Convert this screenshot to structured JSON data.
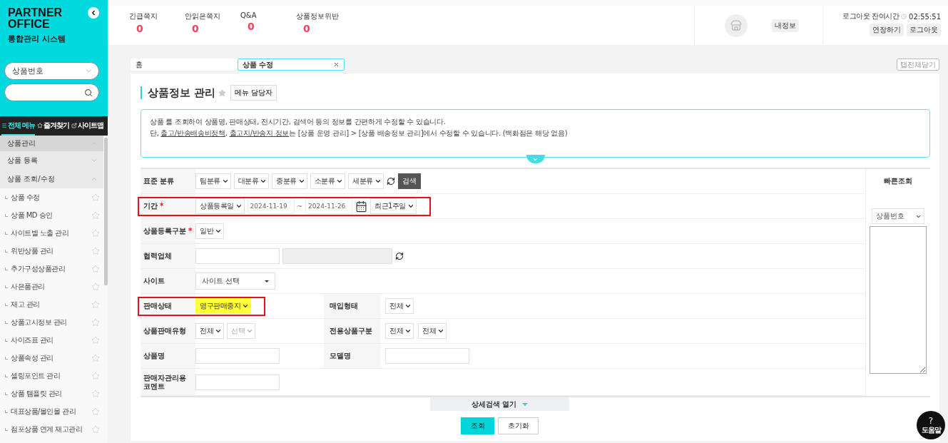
{
  "logo": {
    "title": "PARTNER OFFICE",
    "subtitle": "통합관리 시스템"
  },
  "sidebar_search": {
    "select": "상품번호"
  },
  "sidebar_tabs": [
    {
      "label": "전체 메뉴",
      "selected": true,
      "kind": "menu"
    },
    {
      "label": "즐겨찾기",
      "selected": false,
      "kind": "star"
    },
    {
      "label": "사이트맵",
      "selected": false,
      "kind": "external"
    }
  ],
  "menu": [
    {
      "label": "상품관리",
      "expanded": true,
      "children": [
        {
          "label": "상품 등록",
          "expanded": false
        },
        {
          "label": "상품 조회/수정",
          "expanded": true,
          "children": [
            {
              "label": "상품 수정",
              "favorite": false
            },
            {
              "label": "상품 MD 승인",
              "favorite": false
            },
            {
              "label": "사이트별 노출 관리",
              "favorite": false
            },
            {
              "label": "위반상품 관리",
              "favorite": false
            },
            {
              "label": "추가구성상품관리",
              "favorite": false
            },
            {
              "label": "사은품관리",
              "favorite": false
            },
            {
              "label": "재고 관리",
              "favorite": false
            },
            {
              "label": "상품고시정보 관리",
              "favorite": false
            },
            {
              "label": "사이즈표 관리",
              "favorite": false
            },
            {
              "label": "상품속성 관리",
              "favorite": false
            },
            {
              "label": "셀링포인트 관리",
              "favorite": false
            },
            {
              "label": "상품 템플릿 관리",
              "favorite": false
            },
            {
              "label": "대표상품/몰인몰 관리",
              "favorite": false
            },
            {
              "label": "점포상품 연계 재고관리",
              "favorite": false
            }
          ]
        }
      ]
    }
  ],
  "stats": [
    {
      "label": "긴급쪽지",
      "value": "0"
    },
    {
      "label": "안읽은쪽지",
      "value": "0"
    },
    {
      "label": "Q&A",
      "value": "0"
    },
    {
      "label": "상품정보위반",
      "value": "0"
    }
  ],
  "my_info": {
    "button": "내정보"
  },
  "session": {
    "label": "로그아웃 잔여시간",
    "time": "02:55:51",
    "buttons": [
      "연장하기",
      "로그아웃"
    ]
  },
  "tabs": [
    {
      "label": "홈",
      "selected": false,
      "closable": false
    },
    {
      "label": "상품 수정",
      "selected": true,
      "closable": true
    }
  ],
  "close_all": "탭전체닫기",
  "page": {
    "title": "상품정보 관리",
    "favorite": false,
    "manager_button": "메뉴 담당자"
  },
  "info": {
    "expanded": false,
    "lines": [
      [
        {
          "kind": "text",
          "text": "상품 를 조회하여 상품명, 판매상태, 전시기간, 검색어 등의 정보를 간편하게 수정할 수 있습니다."
        }
      ],
      [
        {
          "kind": "text",
          "text": "단, "
        },
        {
          "kind": "link",
          "text": "출고/반송배송비정책"
        },
        {
          "kind": "text",
          "text": ", "
        },
        {
          "kind": "link",
          "text": "출고지/반송지 정보"
        },
        {
          "kind": "text",
          "text": "는 [상품 운영 관리] > [상품 배송정보 관리]에서 수정할 수 있습니다. (백화점은 해당 없음)"
        }
      ]
    ]
  },
  "form": {
    "required_mark": "*",
    "rows": [
      {
        "label": "표준 분류",
        "required": false,
        "outlined": false,
        "controls": [
          {
            "kind": "select",
            "value": "팀분류"
          },
          {
            "kind": "select",
            "value": "대분류"
          },
          {
            "kind": "select",
            "value": "중분류"
          },
          {
            "kind": "select",
            "value": "소분류"
          },
          {
            "kind": "select",
            "value": "세분류"
          },
          {
            "kind": "refresh"
          },
          {
            "kind": "button",
            "value": "검색"
          }
        ]
      },
      {
        "label": "기간",
        "required": true,
        "outlined": true,
        "controls": [
          {
            "kind": "select",
            "value": "상품등록일"
          },
          {
            "kind": "date",
            "value": "2024-11-19"
          },
          {
            "kind": "separator",
            "value": "~"
          },
          {
            "kind": "date",
            "value": "2024-11-26"
          },
          {
            "kind": "calendar"
          },
          {
            "kind": "select",
            "value": "최근1주일"
          }
        ]
      },
      {
        "label": "상품등록구분",
        "required": true,
        "outlined": false,
        "controls": [
          {
            "kind": "select",
            "value": "일반"
          }
        ]
      },
      {
        "label": "협력업체",
        "required": false,
        "outlined": false,
        "controls": [
          {
            "kind": "input",
            "disabled": false
          },
          {
            "kind": "input",
            "disabled": true
          },
          {
            "kind": "refresh"
          }
        ]
      },
      {
        "label": "사이트",
        "required": false,
        "outlined": false,
        "controls": [
          {
            "kind": "dropdown",
            "value": "사이트 선택"
          }
        ]
      },
      {
        "label": "판매상태",
        "required": false,
        "outlined": true,
        "controls": [
          {
            "kind": "select",
            "value": "영구판매중지",
            "highlighted": true
          }
        ],
        "right": {
          "label": "매입형태",
          "controls": [
            {
              "kind": "select",
              "value": "전체"
            }
          ]
        }
      },
      {
        "label": "상품판매유형",
        "required": false,
        "outlined": false,
        "controls": [
          {
            "kind": "select",
            "value": "전체"
          },
          {
            "kind": "select",
            "value": "선택",
            "disabled": true
          }
        ],
        "right": {
          "label": "전용상품구분",
          "controls": [
            {
              "kind": "select",
              "value": "전체"
            },
            {
              "kind": "select",
              "value": "전체"
            }
          ]
        }
      },
      {
        "label": "상품명",
        "required": false,
        "outlined": false,
        "controls": [
          {
            "kind": "input",
            "disabled": false
          }
        ],
        "right": {
          "label": "모델명",
          "controls": [
            {
              "kind": "input",
              "disabled": false
            }
          ]
        }
      },
      {
        "label": "판매자관리용 코멘트",
        "required": false,
        "outlined": false,
        "controls": [
          {
            "kind": "input",
            "disabled": false
          }
        ]
      }
    ]
  },
  "quick_search": {
    "title": "빠른조회",
    "select": "상품번호"
  },
  "detail_toggle": {
    "label": "상세검색 열기",
    "expanded": false
  },
  "actions": [
    {
      "label": "조회",
      "primary": true
    },
    {
      "label": "초기화",
      "primary": false
    }
  ],
  "help": {
    "icon": "?",
    "label": "도움말"
  }
}
